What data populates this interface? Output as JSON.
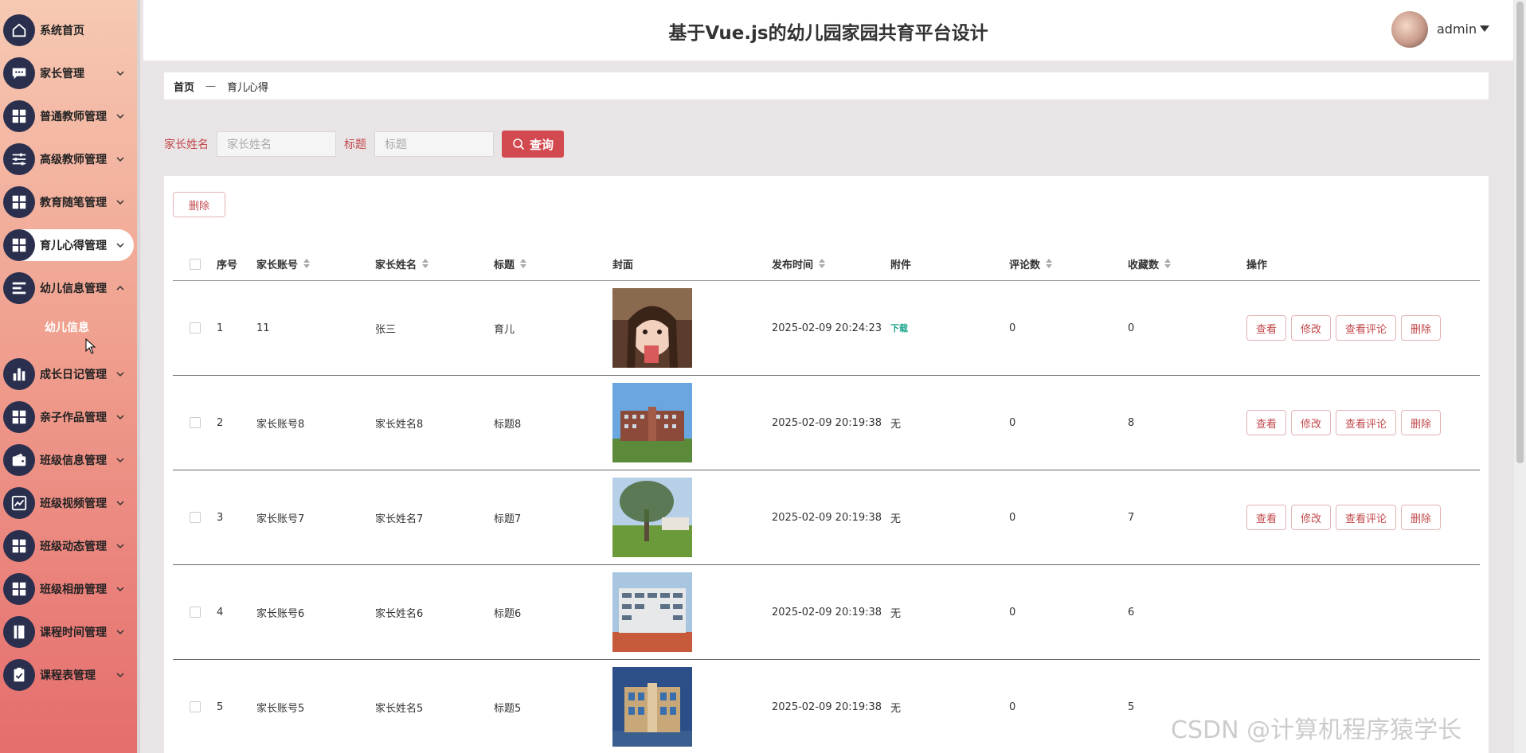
{
  "header": {
    "title": "基于Vue.js的幼儿园家园共育平台设计",
    "user": "admin"
  },
  "sidebar": {
    "items": [
      {
        "label": "系统首页",
        "icon": "home-icon",
        "expandable": false
      },
      {
        "label": "家长管理",
        "icon": "chat-icon",
        "expandable": true
      },
      {
        "label": "普通教师管理",
        "icon": "grid-icon",
        "expandable": true
      },
      {
        "label": "高级教师管理",
        "icon": "sliders-icon",
        "expandable": true
      },
      {
        "label": "教育随笔管理",
        "icon": "grid-icon",
        "expandable": true
      },
      {
        "label": "育儿心得管理",
        "icon": "grid-icon",
        "expandable": true,
        "active": true
      },
      {
        "label": "幼儿信息管理",
        "icon": "list-icon",
        "expandable": true,
        "expanded": true
      },
      {
        "label": "成长日记管理",
        "icon": "bar-chart-icon",
        "expandable": true
      },
      {
        "label": "亲子作品管理",
        "icon": "grid-icon",
        "expandable": true
      },
      {
        "label": "班级信息管理",
        "icon": "wallet-icon",
        "expandable": true
      },
      {
        "label": "班级视频管理",
        "icon": "trend-icon",
        "expandable": true
      },
      {
        "label": "班级动态管理",
        "icon": "grid-icon",
        "expandable": true
      },
      {
        "label": "班级相册管理",
        "icon": "grid-icon",
        "expandable": true
      },
      {
        "label": "课程时间管理",
        "icon": "book-icon",
        "expandable": true
      },
      {
        "label": "课程表管理",
        "icon": "clipboard-icon",
        "expandable": true
      }
    ],
    "sub_item": "幼儿信息"
  },
  "breadcrumb": {
    "home": "首页",
    "sep": "—",
    "current": "育儿心得"
  },
  "search": {
    "name_label": "家长姓名",
    "name_placeholder": "家长姓名",
    "title_label": "标题",
    "title_placeholder": "标题",
    "button": "查询"
  },
  "toolbar": {
    "delete_label": "删除"
  },
  "table": {
    "headers": {
      "idx": "序号",
      "account": "家长账号",
      "name": "家长姓名",
      "title": "标题",
      "cover": "封面",
      "time": "发布时间",
      "attach": "附件",
      "comments": "评论数",
      "favorites": "收藏数",
      "ops": "操作"
    },
    "op_labels": {
      "view": "查看",
      "edit": "修改",
      "comments": "查看评论",
      "delete": "删除"
    },
    "rows": [
      {
        "idx": "1",
        "account": "11",
        "name": "张三",
        "title": "育儿",
        "time": "2025-02-09 20:24:23",
        "attach": "下载",
        "comments": "0",
        "favorites": "0",
        "cover": "girl-photo",
        "show_ops": true
      },
      {
        "idx": "2",
        "account": "家长账号8",
        "name": "家长姓名8",
        "title": "标题8",
        "time": "2025-02-09 20:19:38",
        "attach": "无",
        "comments": "0",
        "favorites": "8",
        "cover": "campus-photo",
        "show_ops": true
      },
      {
        "idx": "3",
        "account": "家长账号7",
        "name": "家长姓名7",
        "title": "标题7",
        "time": "2025-02-09 20:19:38",
        "attach": "无",
        "comments": "0",
        "favorites": "7",
        "cover": "tree-photo",
        "show_ops": true
      },
      {
        "idx": "4",
        "account": "家长账号6",
        "name": "家长姓名6",
        "title": "标题6",
        "time": "2025-02-09 20:19:38",
        "attach": "无",
        "comments": "0",
        "favorites": "6",
        "cover": "building-photo",
        "show_ops": false
      },
      {
        "idx": "5",
        "account": "家长账号5",
        "name": "家长姓名5",
        "title": "标题5",
        "time": "2025-02-09 20:19:38",
        "attach": "无",
        "comments": "0",
        "favorites": "5",
        "cover": "school-photo",
        "show_ops": false
      }
    ]
  },
  "watermark": "CSDN @计算机程序猿学长",
  "colors": {
    "accent": "#d24a4f",
    "sidebar_top": "#f6c9b3",
    "sidebar_bottom": "#e56d6d",
    "icon_bg": "#2a2f4e"
  }
}
